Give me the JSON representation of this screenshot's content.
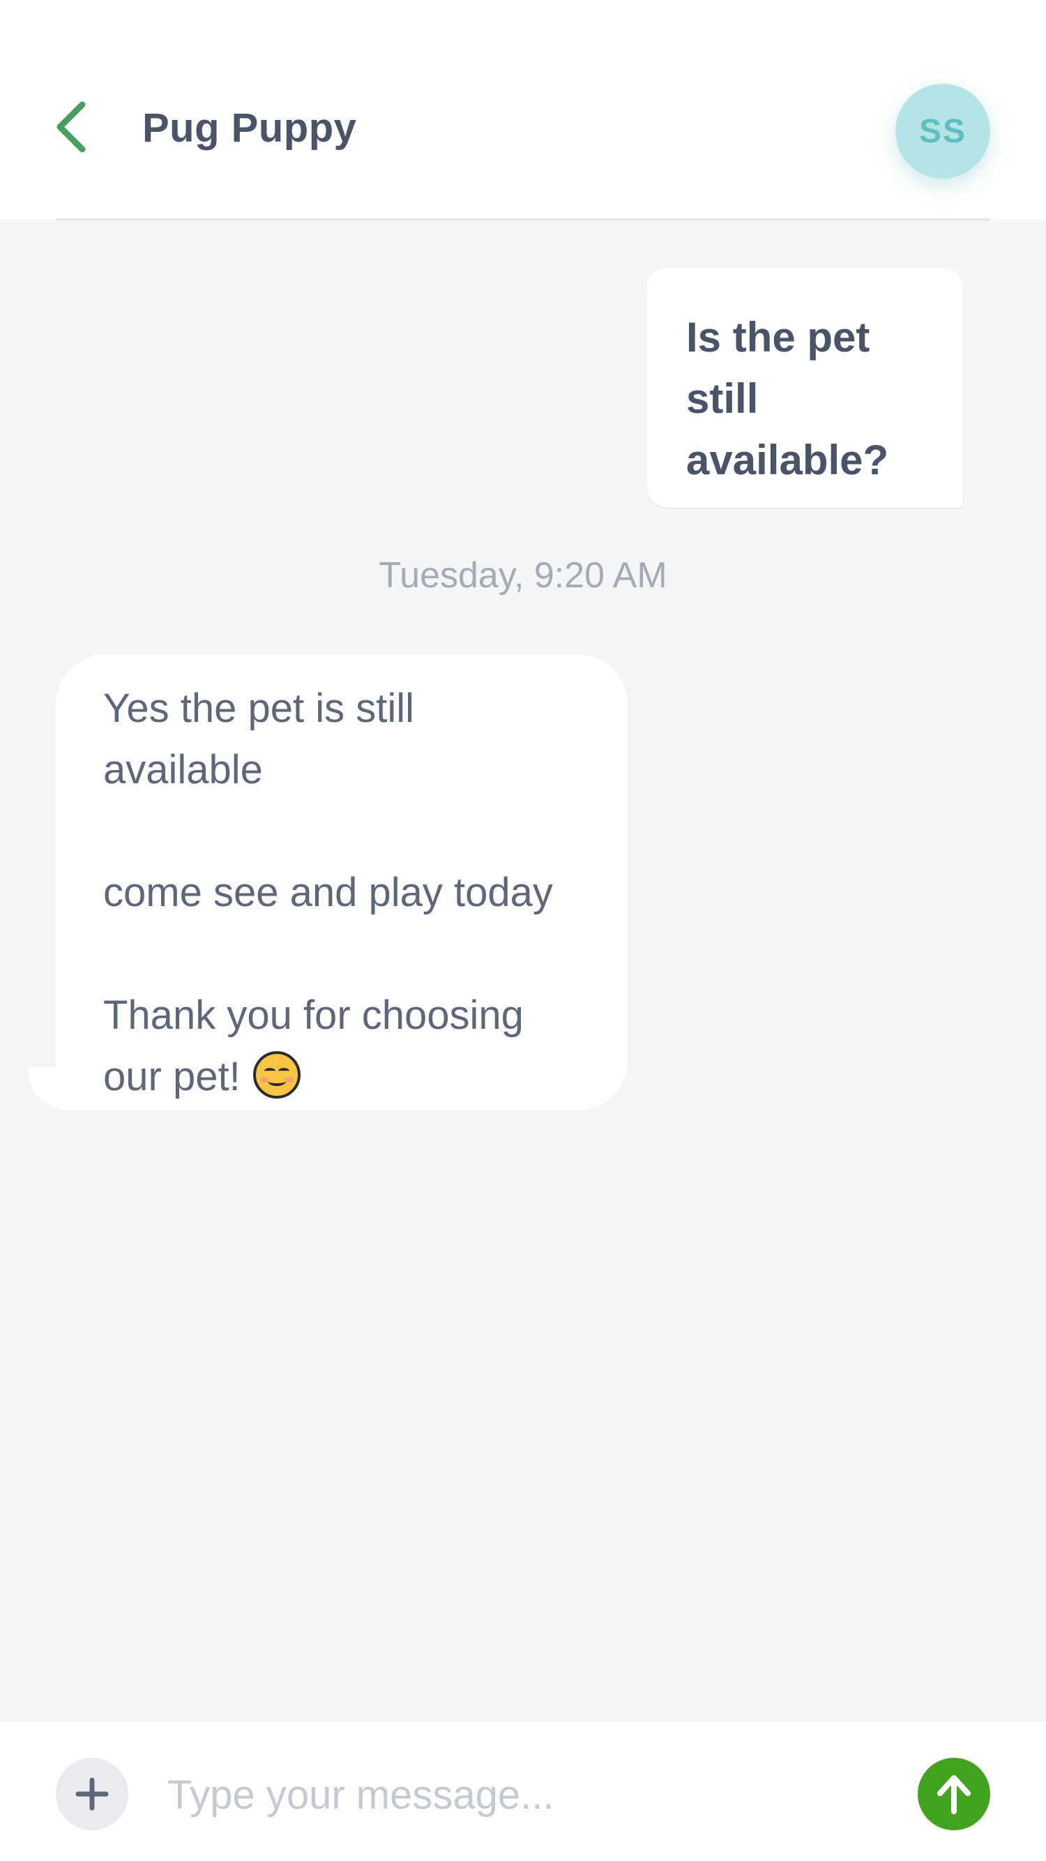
{
  "header": {
    "title": "Pug Puppy",
    "back_icon": "chevron-left-icon",
    "avatar_initials": "SS"
  },
  "messages": {
    "sent": {
      "lines": [
        "Is the pet still",
        "available?"
      ]
    },
    "timestamp": "Tuesday, 9:20 AM",
    "received": {
      "lines": [
        "Yes the pet is still",
        "available",
        "",
        "come see and play today",
        "",
        "Thank you for choosing",
        "our pet!"
      ],
      "emoji": "smiling-face-icon"
    }
  },
  "composer": {
    "placeholder": "Type your message...",
    "add_icon": "plus-icon",
    "send_icon": "arrow-up-icon"
  },
  "colors": {
    "accent_green": "#43a320",
    "back_green": "#4a9e60",
    "avatar_bg": "#b6e4e6",
    "avatar_text": "#5ebfc0",
    "background": "#f4f5f7"
  }
}
